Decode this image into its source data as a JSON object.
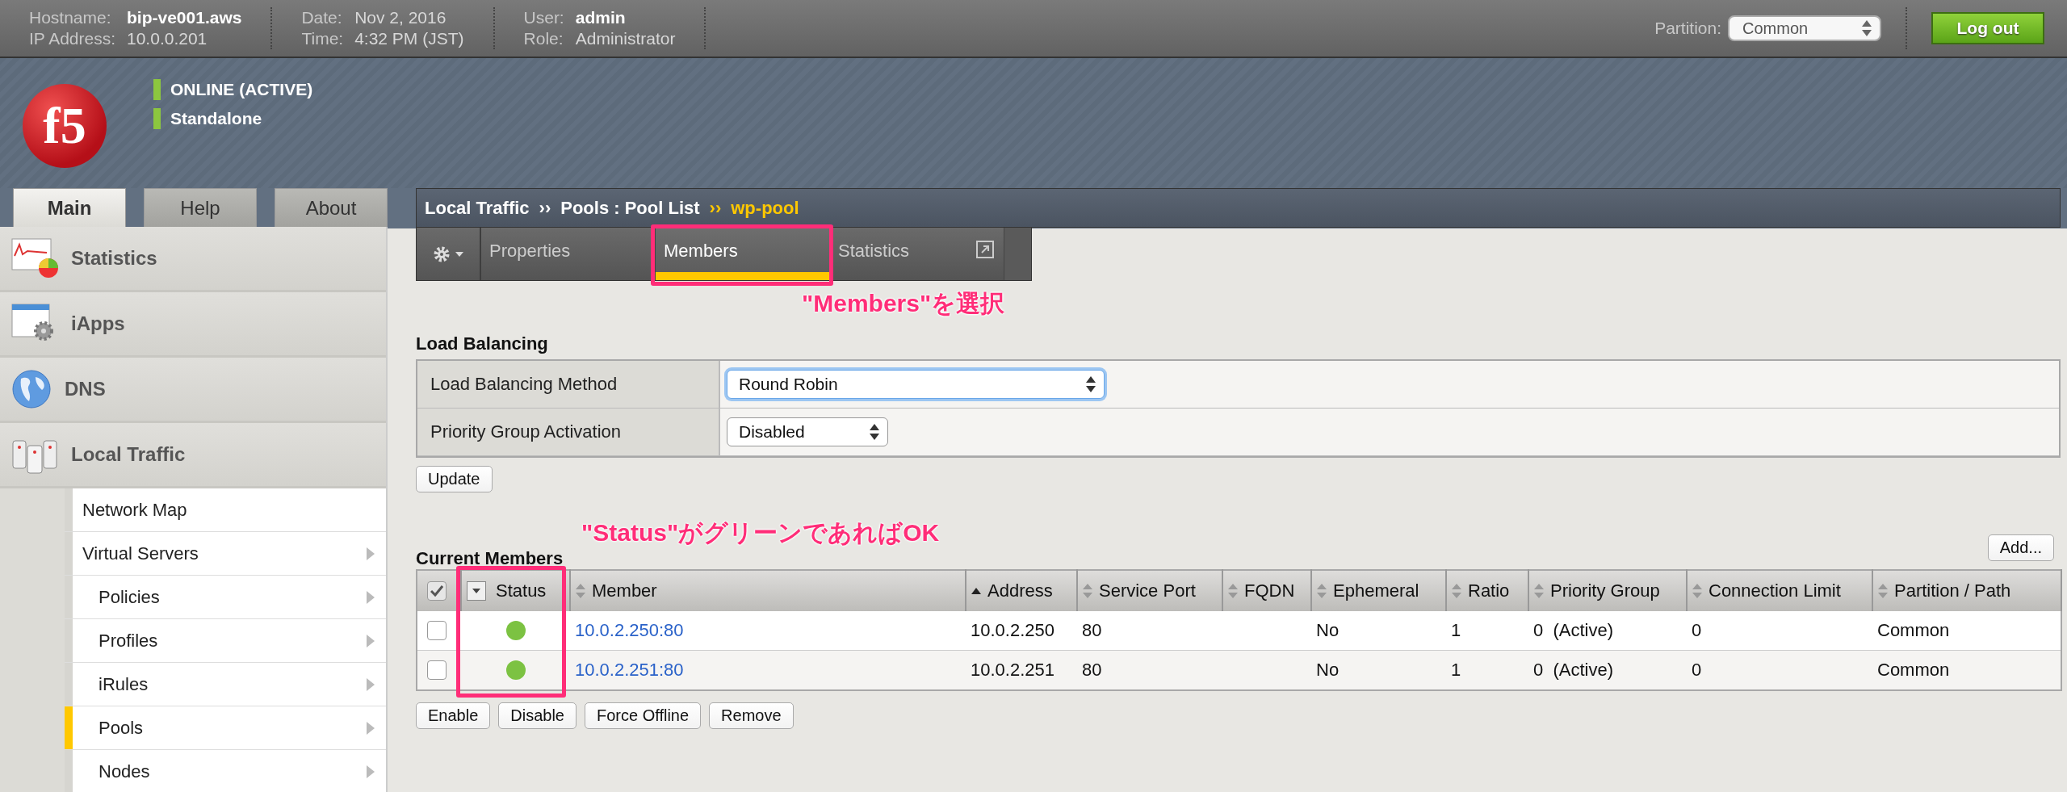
{
  "top_bar": {
    "groups": [
      [
        {
          "label": "Hostname:",
          "value": "bip-ve001.aws",
          "emphasized": true
        },
        {
          "label": "IP Address:",
          "value": "10.0.0.201",
          "emphasized": false
        }
      ],
      [
        {
          "label": "Date:",
          "value": "Nov 2, 2016",
          "emphasized": false
        },
        {
          "label": "Time:",
          "value": "4:32 PM (JST)",
          "emphasized": false
        }
      ],
      [
        {
          "label": "User:",
          "value": "admin",
          "emphasized": true
        },
        {
          "label": "Role:",
          "value": "Administrator",
          "emphasized": false
        }
      ]
    ],
    "partition": {
      "label": "Partition:",
      "value": "Common"
    },
    "logout": "Log out"
  },
  "banner": {
    "logo_text": "f5",
    "status_lines": [
      "ONLINE (ACTIVE)",
      "Standalone"
    ]
  },
  "nav_tabs": [
    {
      "label": "Main",
      "selected": true
    },
    {
      "label": "Help",
      "selected": false
    },
    {
      "label": "About",
      "selected": false
    }
  ],
  "sidebar": {
    "sections": [
      {
        "label": "Statistics"
      },
      {
        "label": "iApps"
      },
      {
        "label": "DNS"
      },
      {
        "label": "Local Traffic",
        "children": [
          {
            "label": "Network Map",
            "selected": false,
            "submenu": false
          },
          {
            "label": "Virtual Servers",
            "selected": false,
            "submenu": true,
            "children": [
              {
                "label": "Policies",
                "selected": false,
                "submenu": true
              },
              {
                "label": "Profiles",
                "selected": false,
                "submenu": true
              },
              {
                "label": "iRules",
                "selected": false,
                "submenu": true
              },
              {
                "label": "Pools",
                "selected": true,
                "submenu": true
              },
              {
                "label": "Nodes",
                "selected": false,
                "submenu": true
              }
            ]
          }
        ]
      }
    ]
  },
  "breadcrumb": [
    {
      "text": "Local Traffic",
      "kind": "link"
    },
    {
      "text": "››",
      "kind": "separator"
    },
    {
      "text": "Pools : Pool List",
      "kind": "link"
    },
    {
      "text": "››",
      "kind": "current-separator"
    },
    {
      "text": "wp-pool",
      "kind": "current"
    }
  ],
  "page_tabs": [
    {
      "label": "Properties",
      "selected": false,
      "external": false
    },
    {
      "label": "Members",
      "selected": true,
      "external": false
    },
    {
      "label": "Statistics",
      "selected": false,
      "external": true
    }
  ],
  "annotations": [
    {
      "text": "\"Members\"を選択"
    },
    {
      "text": "\"Status\"がグリーンであればOK"
    }
  ],
  "load_balancing": {
    "title": "Load Balancing",
    "rows": [
      {
        "label": "Load Balancing Method",
        "value": "Round Robin",
        "focused": true
      },
      {
        "label": "Priority Group Activation",
        "value": "Disabled",
        "focused": false
      }
    ],
    "update_button": "Update"
  },
  "current_members": {
    "title": "Current Members",
    "add_button": "Add...",
    "columns": [
      {
        "kind": "checkbox",
        "checked": true
      },
      {
        "kind": "menu",
        "label": "Status"
      },
      {
        "kind": "sort",
        "label": "Member",
        "sorted": false
      },
      {
        "kind": "sort",
        "label": "Address",
        "sorted": true
      },
      {
        "kind": "sort",
        "label": "Service Port",
        "sorted": false
      },
      {
        "kind": "sort",
        "label": "FQDN",
        "sorted": false
      },
      {
        "kind": "sort",
        "label": "Ephemeral",
        "sorted": false
      },
      {
        "kind": "sort",
        "label": "Ratio",
        "sorted": false
      },
      {
        "kind": "sort",
        "label": "Priority Group",
        "sorted": false
      },
      {
        "kind": "sort",
        "label": "Connection Limit",
        "sorted": false
      },
      {
        "kind": "sort",
        "label": "Partition / Path",
        "sorted": false
      }
    ],
    "rows": [
      {
        "checked": false,
        "color": "#7cc242",
        "member": "10.0.2.250:80",
        "address": "10.0.2.250",
        "port": "80",
        "ephemeral": "No",
        "ratio": "1",
        "priority": "0  (Active)",
        "connection_limit": "0",
        "partition": "Common"
      },
      {
        "checked": false,
        "color": "#7cc242",
        "member": "10.0.2.251:80",
        "address": "10.0.2.251",
        "port": "80",
        "ephemeral": "No",
        "ratio": "1",
        "priority": "0  (Active)",
        "connection_limit": "0",
        "partition": "Common"
      }
    ],
    "buttons": [
      "Enable",
      "Disable",
      "Force Offline",
      "Remove"
    ]
  }
}
